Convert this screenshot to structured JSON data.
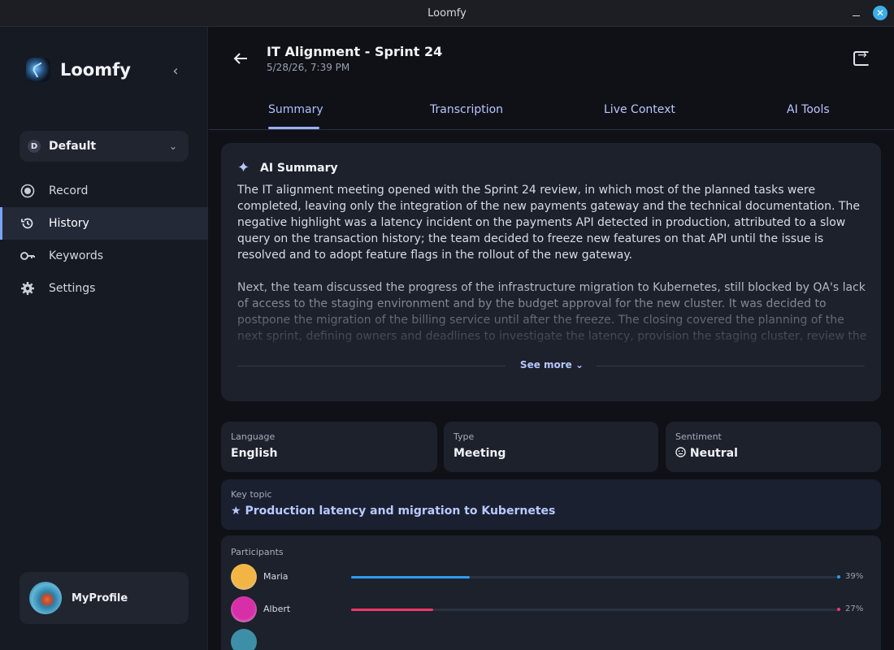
{
  "window": {
    "title": "Loomfy"
  },
  "sidebar": {
    "brand": "Loomfy",
    "workspace": {
      "badge": "D",
      "label": "Default"
    },
    "items": [
      {
        "label": "Record",
        "icon": "record-icon",
        "active": false
      },
      {
        "label": "History",
        "icon": "history-icon",
        "active": true
      },
      {
        "label": "Keywords",
        "icon": "key-icon",
        "active": false
      },
      {
        "label": "Settings",
        "icon": "gear-icon",
        "active": false
      }
    ],
    "profile": {
      "name": "MyProfile"
    }
  },
  "header": {
    "title": "IT Alignment - Sprint 24",
    "date": "5/28/26, 7:39 PM"
  },
  "tabs": [
    {
      "label": "Summary",
      "active": true
    },
    {
      "label": "Transcription",
      "active": false
    },
    {
      "label": "Live Context",
      "active": false
    },
    {
      "label": "AI Tools",
      "active": false
    }
  ],
  "summary": {
    "title": "AI Summary",
    "paragraphs": [
      "The IT alignment meeting opened with the Sprint 24 review, in which most of the planned tasks were completed, leaving only the integration of the new payments gateway and the technical documentation. The negative highlight was a latency incident on the payments API detected in production, attributed to a slow query on the transaction history; the team decided to freeze new features on that API until the issue is resolved and to adopt feature flags in the rollout of the new gateway.",
      "Next, the team discussed the progress of the infrastructure migration to Kubernetes, still blocked by QA's lack of access to the staging environment and by the budget approval for the new cluster. It was decided to postpone the migration of the billing service until after the freeze. The closing covered the planning of the next sprint, defining owners and deadlines to investigate the latency, provision the staging cluster, review the migration ADR"
    ],
    "see_more": "See more"
  },
  "info": {
    "language": {
      "label": "Language",
      "value": "English"
    },
    "type": {
      "label": "Type",
      "value": "Meeting"
    },
    "sentiment": {
      "label": "Sentiment",
      "value": "Neutral",
      "icon": "neutral-face-icon"
    }
  },
  "key_topic": {
    "label": "Key topic",
    "value": "Production latency and migration to Kubernetes",
    "icon": "star-icon"
  },
  "participants": {
    "label": "Participants",
    "list": [
      {
        "name": "Maria",
        "percent": "39%",
        "share": 0.39,
        "color": "#2f9bf0",
        "avatar_color": "#f2b544"
      },
      {
        "name": "Albert",
        "percent": "27%",
        "share": 0.27,
        "color": "#f0366a",
        "avatar_color": "#d62fa8"
      }
    ]
  },
  "colors": {
    "accent": "#9bb0ff",
    "background": "#0f1117",
    "card": "#1c212b"
  }
}
